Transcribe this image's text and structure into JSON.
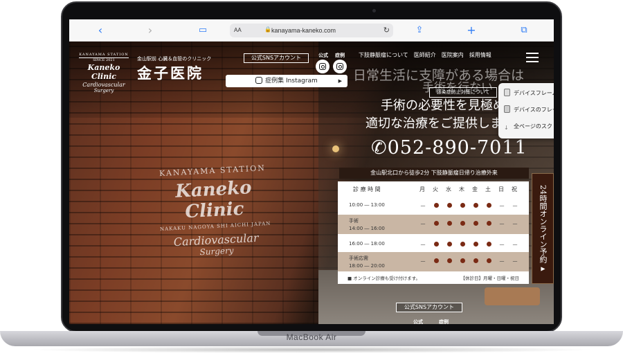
{
  "device": {
    "label": "MacBook Air"
  },
  "browser": {
    "text_size": "AA",
    "url": "kanayama-kaneko.com",
    "icons": [
      "back-icon",
      "forward-icon",
      "bookmarks-icon",
      "share-icon",
      "new-tab-icon",
      "tabs-icon",
      "reload-icon",
      "lock-icon"
    ]
  },
  "header": {
    "logo": {
      "station": "KANAYAMA STATION",
      "since": "SINCE 2021",
      "brand": "Kaneko Clinic",
      "line2": "Cardiovascular",
      "line3": "Surgery"
    },
    "subtitle": "金山駅前 心臓＆血管のクリニック",
    "clinic_name": "金子医院",
    "sns_label": "公式SNSアカウント",
    "sns_official": "公式",
    "sns_cases": "症例",
    "instagram_button": "症例集 Instagram",
    "nav": [
      "下肢静脈瘤について",
      "医師紹介",
      "医院案内",
      "採用情報"
    ],
    "covid": "感染症防止対策について"
  },
  "hero": {
    "line1": "日常生活に支障がある場合は",
    "line1b": "手術を行ない",
    "line2": "手術の必要性を見極め",
    "line3": "適切な治療をご提供します",
    "phone": "052-890-7011"
  },
  "context_menu": {
    "items": [
      "デバイスフレーム",
      "デバイスのフレー",
      "全ページのスク"
    ]
  },
  "schedule": {
    "title": "金山駅北口から徒歩2分 下肢静脈瘤日帰り治療外来",
    "header_label": "診 療 時 間",
    "days": [
      "月",
      "火",
      "水",
      "木",
      "金",
      "土",
      "日",
      "祝"
    ],
    "rows": [
      {
        "label": "10:00 ― 13:00",
        "sub": "",
        "shade": false,
        "marks": [
          "—",
          "●",
          "●",
          "●",
          "●",
          "●",
          "—",
          "—"
        ]
      },
      {
        "label": "手術",
        "sub": "14:00 ― 16:00",
        "shade": true,
        "marks": [
          "—",
          "●",
          "●",
          "●",
          "●",
          "●",
          "—",
          "—"
        ]
      },
      {
        "label": "16:00 ― 18:00",
        "sub": "",
        "shade": false,
        "marks": [
          "—",
          "●",
          "●",
          "●",
          "●",
          "●",
          "—",
          "—"
        ]
      },
      {
        "label": "手術応需",
        "sub": "18:00 ― 20:00",
        "shade": true,
        "marks": [
          "—",
          "●",
          "●",
          "●",
          "●",
          "●",
          "—",
          "—"
        ]
      }
    ],
    "note": "■ オンライン診療も受け付けます。",
    "holiday": "【休診日】月曜・日曜・祝日"
  },
  "booking": {
    "label": "24時間オンライン予約",
    "arrow": "▶"
  },
  "footer_sns": {
    "label": "公式SNSアカウント",
    "official": "公式",
    "cases": "症例"
  },
  "wall_sign": {
    "station": "KANAYAMA STATION",
    "brand": "Kaneko Clinic",
    "address": "NAKAKU NAGOYA SHI AICHI JAPAN",
    "line2": "Cardiovascular",
    "line3": "Surgery"
  }
}
